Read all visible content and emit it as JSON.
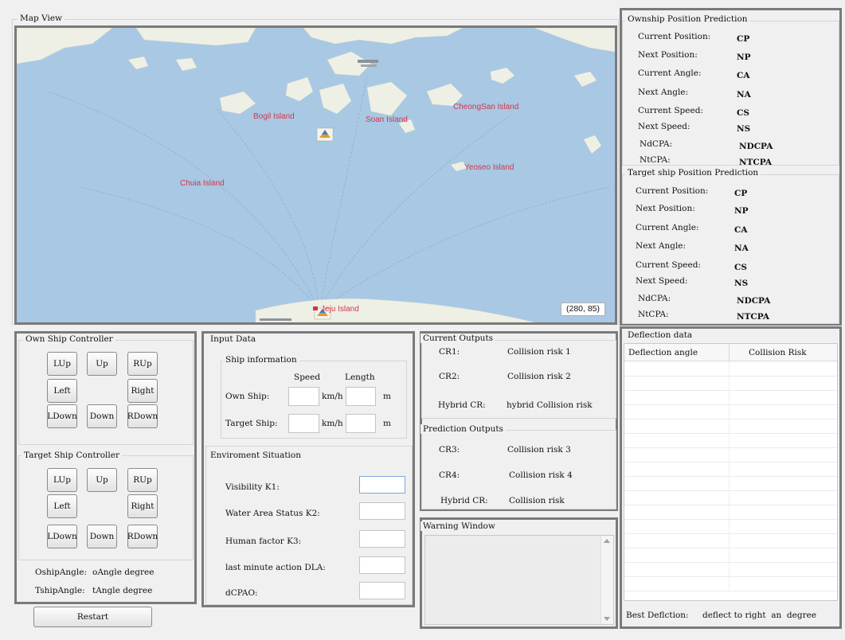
{
  "map": {
    "title": "Map View",
    "labels": {
      "bogil": "Bogil Island",
      "soan": "Soan Island",
      "cheongsan": "CheongSan Island",
      "chuia": "Chuia Island",
      "yeoseo": "Yeoseo Island",
      "jeju": "Jeju Island"
    },
    "coord_readout": "(280, 85)"
  },
  "ownship_pred": {
    "title": "Ownship Position Prediction",
    "rows": [
      {
        "label": "Current Position:",
        "value": "CP"
      },
      {
        "label": "Next Position:",
        "value": "NP"
      },
      {
        "label": "Current Angle:",
        "value": "CA"
      },
      {
        "label": "Next Angle:",
        "value": "NA"
      },
      {
        "label": "Current Speed:",
        "value": "CS"
      },
      {
        "label": "Next Speed:",
        "value": "NS"
      },
      {
        "label": "NdCPA:",
        "value": "NDCPA"
      },
      {
        "label": "NtCPA:",
        "value": "NTCPA"
      }
    ]
  },
  "target_pred": {
    "title": "Target ship Position Prediction",
    "rows": [
      {
        "label": "Current Position:",
        "value": "CP"
      },
      {
        "label": "Next Position:",
        "value": "NP"
      },
      {
        "label": "Current Angle:",
        "value": "CA"
      },
      {
        "label": "Next Angle:",
        "value": "NA"
      },
      {
        "label": "Current Speed:",
        "value": "CS"
      },
      {
        "label": "Next Speed:",
        "value": "NS"
      },
      {
        "label": "NdCPA:",
        "value": "NDCPA"
      },
      {
        "label": "NtCPA:",
        "value": "NTCPA"
      }
    ]
  },
  "own_ctrl": {
    "title": "Own Ship Controller",
    "buttons": {
      "lup": "LUp",
      "up": "Up",
      "rup": "RUp",
      "left": "Left",
      "right": "Right",
      "ldown": "LDown",
      "down": "Down",
      "rdown": "RDown"
    }
  },
  "target_ctrl": {
    "title": "Target Ship Controller",
    "buttons": {
      "lup": "LUp",
      "up": "Up",
      "rup": "RUp",
      "left": "Left",
      "right": "Right",
      "ldown": "LDown",
      "down": "Down",
      "rdown": "RDown"
    }
  },
  "angles": {
    "oship_label": "OshipAngle:",
    "oship_value": "oAngle degree",
    "tship_label": "TshipAngle:",
    "tship_value": "tAngle degree"
  },
  "restart": "Restart",
  "input": {
    "title": "Input Data",
    "ship_info": {
      "title": "Ship information",
      "speed_header": "Speed",
      "length_header": "Length",
      "own_label": "Own Ship:",
      "target_label": "Target Ship:",
      "speed_unit": "km/h",
      "length_unit": "m",
      "own_speed": "",
      "own_length": "",
      "target_speed": "",
      "target_length": ""
    },
    "env": {
      "title": "Enviroment Situation",
      "fields": [
        {
          "label": "Visibility K1:",
          "value": ""
        },
        {
          "label": "Water Area Status K2:",
          "value": ""
        },
        {
          "label": "Human factor K3:",
          "value": ""
        },
        {
          "label": "last minute action DLA:",
          "value": ""
        },
        {
          "label": "dCPAO:",
          "value": ""
        }
      ]
    }
  },
  "current_outputs": {
    "title": "Current Outputs",
    "rows": [
      {
        "label": "CR1:",
        "value": "Collision risk 1"
      },
      {
        "label": "CR2:",
        "value": "Collision risk 2"
      },
      {
        "label": "Hybrid CR:",
        "value": "hybrid Collision risk"
      }
    ]
  },
  "prediction_outputs": {
    "title": "Prediction Outputs",
    "rows": [
      {
        "label": "CR3:",
        "value": "Collision risk 3"
      },
      {
        "label": "CR4:",
        "value": "Collision risk 4"
      },
      {
        "label": "Hybrid CR:",
        "value": "Collision risk"
      }
    ]
  },
  "warning": {
    "title": "Warning Window"
  },
  "deflection": {
    "title": "Deflection data",
    "col1": "Deflection angle",
    "col2": "Collision Risk",
    "best_label": "Best Deflction:",
    "best_value": "deflect to right  an  degree"
  },
  "colors": {
    "sea": "#a9c8e4",
    "land": "#eef0e6",
    "accent_text": "#d3364a"
  }
}
